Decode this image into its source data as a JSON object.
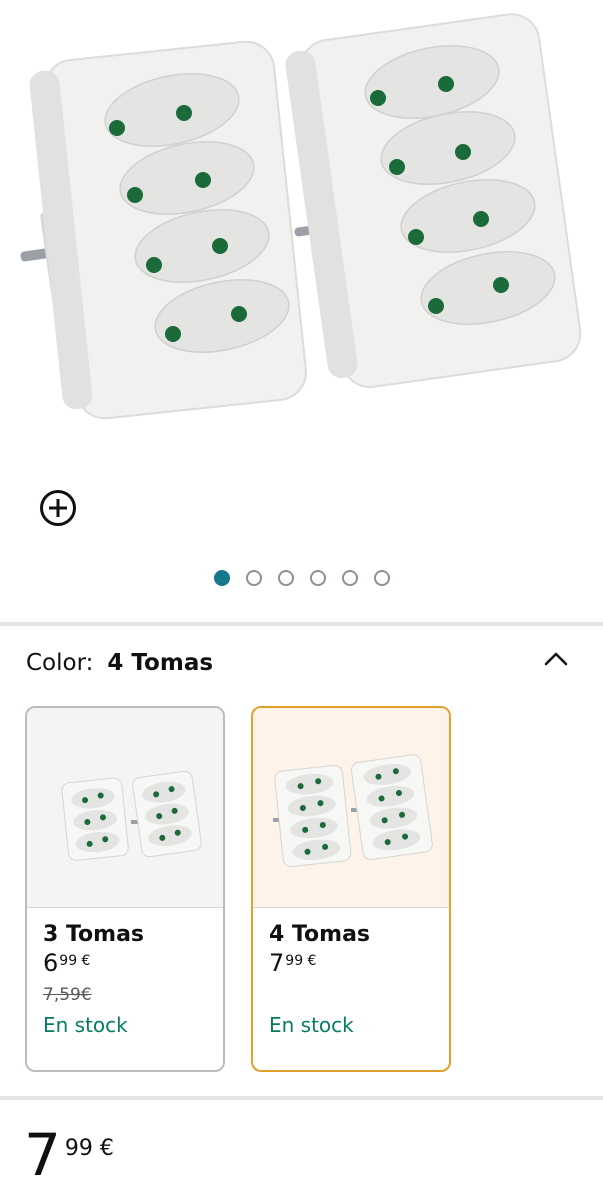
{
  "gallery": {
    "dots_total": 6,
    "dots_active_index": 0
  },
  "variation": {
    "label": "Color:",
    "selected_value": "4 Tomas"
  },
  "options": [
    {
      "title": "3 Tomas",
      "price_whole": "6",
      "price_fraction": "99 €",
      "old_price": "7,59€",
      "stock": "En stock",
      "selected": false
    },
    {
      "title": "4 Tomas",
      "price_whole": "7",
      "price_fraction": "99 €",
      "old_price": "",
      "stock": "En stock",
      "selected": true
    }
  ],
  "price": {
    "whole": "7",
    "fraction": "99 €"
  },
  "colors": {
    "accent_dot": "#147a8b",
    "selected_border": "#e3a02a",
    "stock_green": "#067d62",
    "outlet_hole": "#1a6a3a"
  }
}
